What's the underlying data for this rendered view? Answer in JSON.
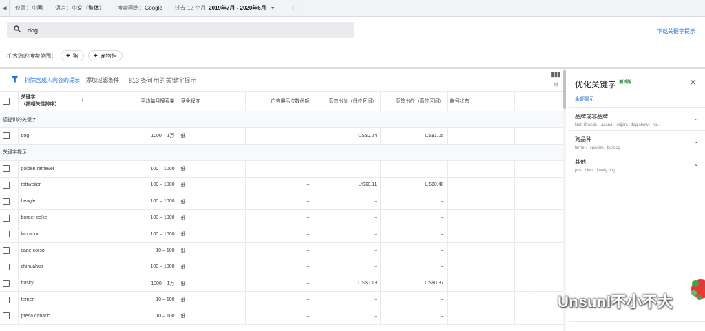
{
  "topbar": {
    "location_label": "位置：",
    "location_value": "中国",
    "language_label": "语言：",
    "language_value": "中文（繁体）",
    "network_label": "搜索网络：",
    "network_value": "Google",
    "period_label": "过去 12 个月",
    "period_value": "2019年7月 - 2020年6月"
  },
  "search": {
    "value": "dog"
  },
  "download_label": "下载关键字提示",
  "broaden": {
    "label": "扩大您的搜索范围：",
    "chips": [
      "狗",
      "宠物狗"
    ]
  },
  "toolbar": {
    "exclude_label": "排除含成人内容的提示",
    "add_filter_label": "添加过滤条件",
    "count_label": "813 条可用的关键字提示",
    "columns_label": "列"
  },
  "table": {
    "headers": {
      "keyword_line1": "关键字",
      "keyword_line2": "（按相关性排序）",
      "volume": "平均每月搜索量",
      "competition": "竞争程度",
      "impression_share": "广告展示次数份额",
      "bid_low": "页首出价（低位区间）",
      "bid_high": "页首出价（高位区间）",
      "account_status": "帐号状态"
    },
    "provided_section": "您提供的关键字",
    "ideas_section": "关键字提示",
    "provided": [
      {
        "keyword": "dog",
        "volume": "1000 – 1万",
        "competition": "低",
        "impression_share": "–",
        "bid_low": "US$0.24",
        "bid_high": "US$1.05"
      }
    ],
    "ideas": [
      {
        "keyword": "golden retriever",
        "volume": "100 – 1000",
        "competition": "低",
        "impression_share": "–",
        "bid_low": "–",
        "bid_high": "–"
      },
      {
        "keyword": "rottweiler",
        "volume": "100 – 1000",
        "competition": "低",
        "impression_share": "–",
        "bid_low": "US$0.11",
        "bid_high": "US$0.40"
      },
      {
        "keyword": "beagle",
        "volume": "100 – 1000",
        "competition": "低",
        "impression_share": "–",
        "bid_low": "–",
        "bid_high": "–"
      },
      {
        "keyword": "border collie",
        "volume": "100 – 1000",
        "competition": "低",
        "impression_share": "–",
        "bid_low": "–",
        "bid_high": "–"
      },
      {
        "keyword": "labrador",
        "volume": "100 – 1000",
        "competition": "低",
        "impression_share": "–",
        "bid_low": "–",
        "bid_high": "–"
      },
      {
        "keyword": "cane corso",
        "volume": "10 – 100",
        "competition": "低",
        "impression_share": "–",
        "bid_low": "–",
        "bid_high": "–"
      },
      {
        "keyword": "chihuahua",
        "volume": "100 – 1000",
        "competition": "低",
        "impression_share": "–",
        "bid_low": "–",
        "bid_high": "–"
      },
      {
        "keyword": "husky",
        "volume": "1000 – 1万",
        "competition": "低",
        "impression_share": "–",
        "bid_low": "US$0.13",
        "bid_high": "US$0.87"
      },
      {
        "keyword": "terrier",
        "volume": "10 – 100",
        "competition": "低",
        "impression_share": "–",
        "bid_low": "–",
        "bid_high": "–"
      },
      {
        "keyword": "presa canario",
        "volume": "10 – 100",
        "competition": "低",
        "impression_share": "–",
        "bid_low": "–",
        "bid_high": "–"
      }
    ]
  },
  "side": {
    "title": "优化关键字",
    "beta": "测试版",
    "show_all": "全部显示",
    "groups": [
      {
        "title": "品牌或非品牌",
        "subtitle": "Non-Brands、acana、orijen、dog chow、ha..."
      },
      {
        "title": "狗品种",
        "subtitle": "terrier、spaniel、bulldog"
      },
      {
        "title": "其他",
        "subtitle": "pro、club、lovely dog"
      }
    ]
  },
  "watermark": "Unsunl不小不大",
  "colors": {
    "accent": "#1a73e8",
    "beta_green": "#188038"
  }
}
